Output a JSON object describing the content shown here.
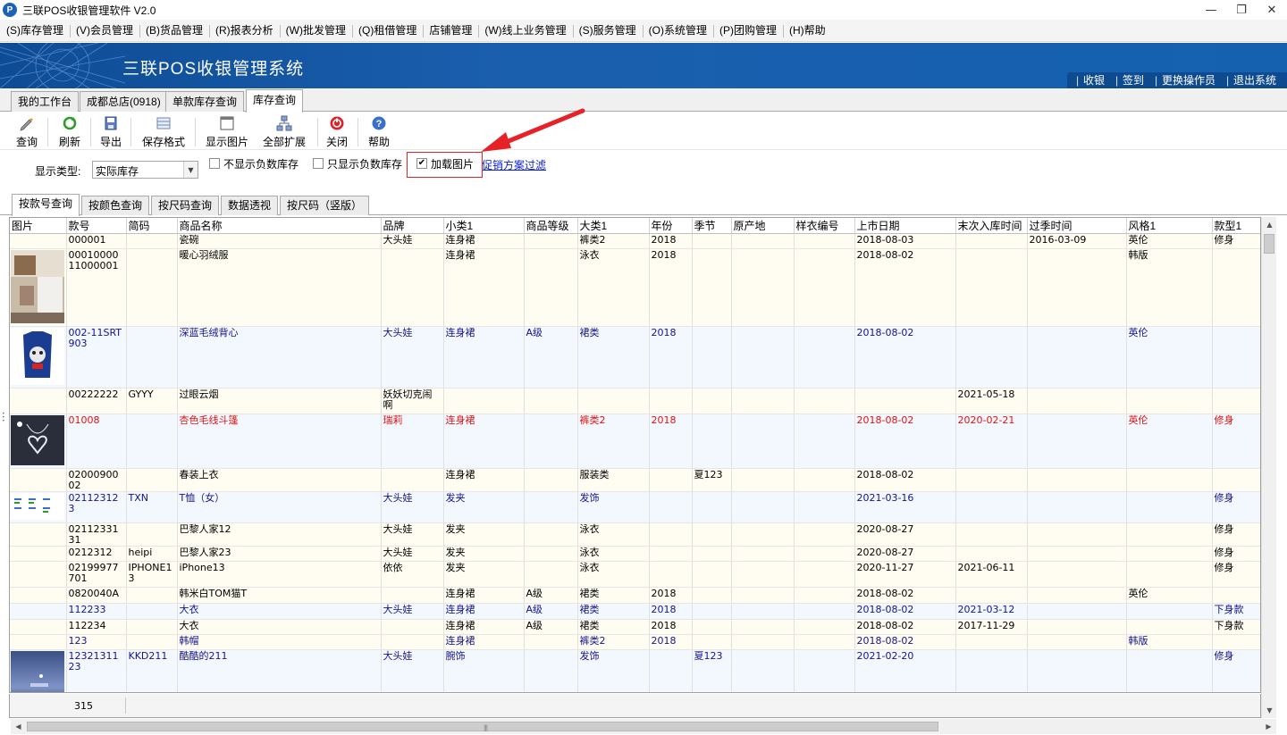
{
  "window": {
    "title": "三联POS收银管理软件 V2.0",
    "icon_letter": "P"
  },
  "menu": [
    "(S)库存管理",
    "(V)会员管理",
    "(B)货品管理",
    "(R)报表分析",
    "(W)批发管理",
    "(Q)租借管理",
    "店铺管理",
    "(W)线上业务管理",
    "(S)服务管理",
    "(O)系统管理",
    "(P)团购管理",
    "(H)帮助"
  ],
  "banner": {
    "title": "三联POS收银管理系统",
    "links": [
      "收银",
      "签到",
      "更换操作员",
      "退出系统"
    ]
  },
  "top_tabs": [
    "我的工作台",
    "成都总店(0918)",
    "单款库存查询",
    "库存查询"
  ],
  "toolbar": [
    "查询",
    "刷新",
    "导出",
    "保存格式",
    "显示图片",
    "全部扩展",
    "关闭",
    "帮助"
  ],
  "filters": {
    "type_label": "显示类型:",
    "type_value": "实际库存",
    "check_no_negative": "不显示负数库存",
    "check_only_negative": "只显示负数库存",
    "check_load_image": "加载图片",
    "load_image_checked": true,
    "promo_link": "促销方案过滤"
  },
  "query_tabs": [
    "按款号查询",
    "按颜色查询",
    "按尺码查询",
    "数据透视",
    "按尺码（竖版）"
  ],
  "grid": {
    "columns": [
      "图片",
      "款号",
      "简码",
      "商品名称",
      "品牌",
      "小类1",
      "商品等级",
      "大类1",
      "年份",
      "季节",
      "原产地",
      "样衣编号",
      "上市日期",
      "末次入库时间",
      "过季时间",
      "风格1",
      "款型1"
    ],
    "rows": [
      {
        "img": "",
        "cells": [
          "000001",
          "",
          "瓷碗",
          "大头娃",
          "连身裙",
          "",
          "裤类2",
          "2018",
          "",
          "",
          "",
          "2018-08-03",
          "",
          "2016-03-09",
          "英伦",
          "修身"
        ]
      },
      {
        "img": "room",
        "cells": [
          "0001000011000001",
          "",
          "暖心羽绒服",
          "",
          "连身裙",
          "",
          "泳衣",
          "2018",
          "",
          "",
          "",
          "2018-08-02",
          "",
          "",
          "韩版",
          ""
        ]
      },
      {
        "img": "sweater",
        "cells": [
          "002-11SRT903",
          "",
          "深蓝毛绒背心",
          "大头娃",
          "连身裙",
          "A级",
          "裙类",
          "2018",
          "",
          "",
          "",
          "2018-08-02",
          "",
          "",
          "英伦",
          ""
        ]
      },
      {
        "img": "",
        "cells": [
          "00222222",
          "GYYY",
          "过眼云烟",
          "妖妖切克闹啊",
          "",
          "",
          "",
          "",
          "",
          "",
          "",
          "",
          "2021-05-18",
          "",
          "",
          ""
        ]
      },
      {
        "img": "necklace",
        "cells": [
          "01008",
          "",
          "杏色毛线斗篷",
          "瑞莉",
          "连身裙",
          "",
          "裤类2",
          "2018",
          "",
          "",
          "",
          "2018-08-02",
          "2020-02-21",
          "",
          "英伦",
          "修身"
        ]
      },
      {
        "img": "",
        "cells": [
          "0200090002",
          "",
          "春装上衣",
          "",
          "连身裙",
          "",
          "服装类",
          "",
          "夏123",
          "",
          "",
          "2018-08-02",
          "",
          "",
          "",
          ""
        ]
      },
      {
        "img": "chart",
        "cells": [
          "021123123",
          "TXN",
          "T恤（女）",
          "大头娃",
          "发夹",
          "",
          "发饰",
          "",
          "",
          "",
          "",
          "2021-03-16",
          "",
          "",
          "",
          "修身"
        ]
      },
      {
        "img": "",
        "cells": [
          "0211233131",
          "",
          "巴黎人家12",
          "大头娃",
          "发夹",
          "",
          "泳衣",
          "",
          "",
          "",
          "",
          "2020-08-27",
          "",
          "",
          "",
          "修身"
        ]
      },
      {
        "img": "",
        "cells": [
          "0212312",
          "heipi",
          "巴黎人家23",
          "大头娃",
          "发夹",
          "",
          "泳衣",
          "",
          "",
          "",
          "",
          "2020-08-27",
          "",
          "",
          "",
          "修身"
        ]
      },
      {
        "img": "",
        "cells": [
          "02199977701",
          "IPHONE13",
          "iPhone13",
          "依依",
          "发夹",
          "",
          "泳衣",
          "",
          "",
          "",
          "",
          "2020-11-27",
          "2021-06-11",
          "",
          "",
          "修身"
        ]
      },
      {
        "img": "",
        "cells": [
          "0820040A",
          "",
          "韩米白TOM猫T",
          "",
          "连身裙",
          "A级",
          "裙类",
          "2018",
          "",
          "",
          "",
          "2018-08-02",
          "",
          "",
          "英伦",
          ""
        ]
      },
      {
        "img": "",
        "cells": [
          "112233",
          "",
          "大衣",
          "大头娃",
          "连身裙",
          "A级",
          "裙类",
          "2018",
          "",
          "",
          "",
          "2018-08-02",
          "2021-03-12",
          "",
          "",
          "下身款"
        ]
      },
      {
        "img": "",
        "cells": [
          "112234",
          "",
          "大衣",
          "",
          "连身裙",
          "A级",
          "裙类",
          "2018",
          "",
          "",
          "",
          "2018-08-02",
          "2017-11-29",
          "",
          "",
          "下身款"
        ]
      },
      {
        "img": "",
        "cells": [
          "123",
          "",
          "韩帽",
          "",
          "连身裙",
          "",
          "裤类2",
          "2018",
          "",
          "",
          "",
          "2018-08-02",
          "",
          "",
          "韩版",
          ""
        ]
      },
      {
        "img": "phone",
        "cells": [
          "1232131123",
          "KKD211",
          "酷酷的211",
          "大头娃",
          "腕饰",
          "",
          "发饰",
          "",
          "夏123",
          "",
          "",
          "2021-02-20",
          "",
          "",
          "",
          "修身"
        ]
      }
    ],
    "total_count": "315"
  },
  "colors": {
    "banner": "#1561b0",
    "row_blue": "#14148c",
    "row_red": "#e21212",
    "highlight": "#e0222a",
    "link": "#0a1fd6"
  }
}
